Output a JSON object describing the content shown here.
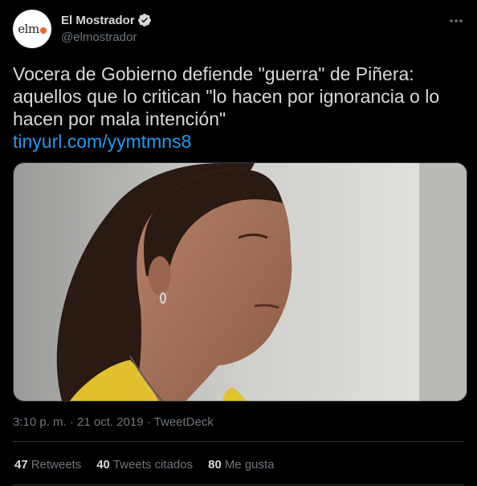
{
  "tweet": {
    "avatar_text": "elm",
    "display_name": "El Mostrador",
    "handle": "@elmostrador",
    "more_icon": "more-icon",
    "text_lines": [
      "Vocera de Gobierno defiende \"guerra\" de Piñera:",
      "aquellos que lo critican \"lo hacen por ignorancia o lo",
      "hacen por mala intención\""
    ],
    "link": "tinyurl.com/yymtmns8",
    "timestamp": "3:10 p. m. · 21 oct. 2019 · TweetDeck",
    "stats": {
      "retweets_count": "47",
      "retweets_label": "Retweets",
      "quotes_count": "40",
      "quotes_label": "Tweets citados",
      "likes_count": "80",
      "likes_label": "Me gusta"
    }
  },
  "colors": {
    "background": "#000000",
    "text": "#d9d9d9",
    "secondary": "#6e767d",
    "link": "#1d9bf0",
    "divider": "#2f3336",
    "brand_dot": "#f26522"
  }
}
